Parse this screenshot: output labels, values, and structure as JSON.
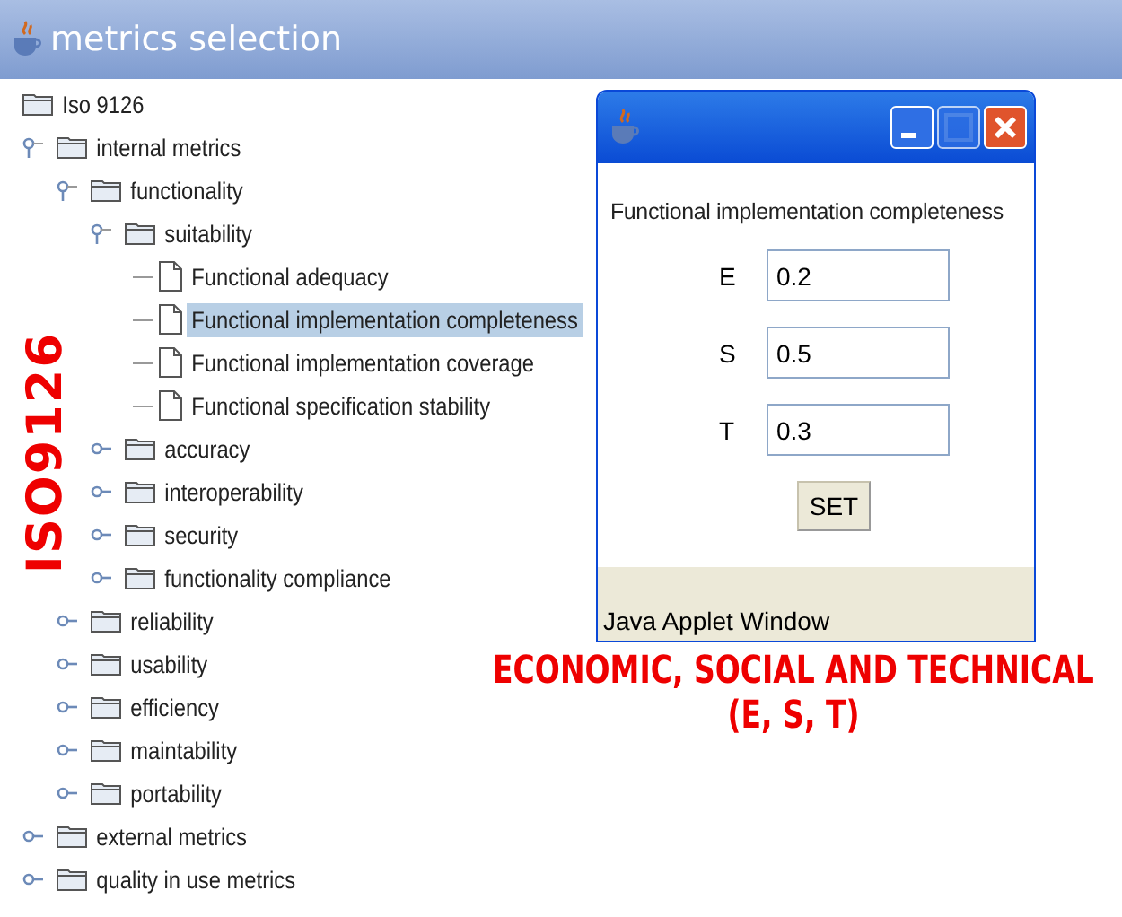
{
  "window": {
    "title": "metrics selection"
  },
  "tree": {
    "label": "Iso 9126",
    "kind": "folder",
    "selected": false,
    "children": [
      {
        "label": "internal metrics",
        "kind": "folder",
        "expanded": true,
        "selected": false,
        "children": [
          {
            "label": "functionality",
            "kind": "folder",
            "expanded": true,
            "selected": false,
            "children": [
              {
                "label": "suitability",
                "kind": "folder",
                "expanded": true,
                "selected": false,
                "children": [
                  {
                    "label": "Functional adequacy",
                    "kind": "leaf",
                    "selected": false
                  },
                  {
                    "label": "Functional implementation completeness",
                    "kind": "leaf",
                    "selected": true
                  },
                  {
                    "label": "Functional implementation coverage",
                    "kind": "leaf",
                    "selected": false
                  },
                  {
                    "label": "Functional specification stability",
                    "kind": "leaf",
                    "selected": false
                  }
                ]
              },
              {
                "label": "accuracy",
                "kind": "folder",
                "expanded": false,
                "selected": false
              },
              {
                "label": "interoperability",
                "kind": "folder",
                "expanded": false,
                "selected": false
              },
              {
                "label": "security",
                "kind": "folder",
                "expanded": false,
                "selected": false
              },
              {
                "label": "functionality compliance",
                "kind": "folder",
                "expanded": false,
                "selected": false
              }
            ]
          },
          {
            "label": "reliability",
            "kind": "folder",
            "expanded": false,
            "selected": false
          },
          {
            "label": "usability",
            "kind": "folder",
            "expanded": false,
            "selected": false
          },
          {
            "label": "efficiency",
            "kind": "folder",
            "expanded": false,
            "selected": false
          },
          {
            "label": "maintability",
            "kind": "folder",
            "expanded": false,
            "selected": false
          },
          {
            "label": "portability",
            "kind": "folder",
            "expanded": false,
            "selected": false
          }
        ]
      },
      {
        "label": "external metrics",
        "kind": "folder",
        "expanded": false,
        "selected": false
      },
      {
        "label": "quality in use metrics",
        "kind": "folder",
        "expanded": false,
        "selected": false
      }
    ]
  },
  "applet": {
    "heading": "Functional implementation completeness",
    "fields": [
      {
        "label": "E",
        "value": "0.2"
      },
      {
        "label": "S",
        "value": "0.5"
      },
      {
        "label": "T",
        "value": "0.3"
      }
    ],
    "button": "SET",
    "status": "Java Applet Window"
  },
  "annotations": {
    "vertical": "ISO9126",
    "caption": [
      "ECONOMIC, SOCIAL AND TECHNICAL",
      "(E, S, T)"
    ]
  }
}
